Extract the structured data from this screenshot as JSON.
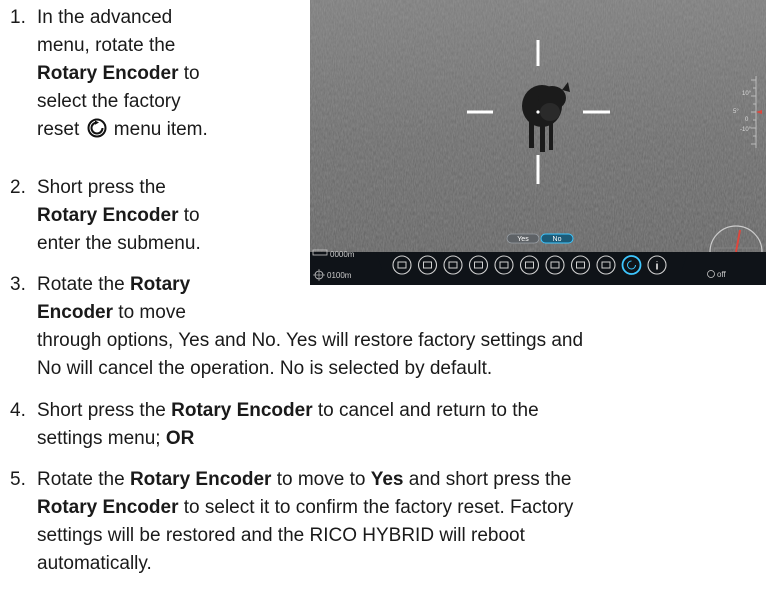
{
  "steps": [
    {
      "number": "1.",
      "lines": [
        [
          "In the advanced"
        ],
        [
          "menu, rotate the"
        ],
        [
          "",
          "Rotary Encoder",
          " to"
        ],
        [
          "select the factory"
        ],
        [
          "reset ",
          "ICON",
          " menu item."
        ]
      ]
    },
    {
      "number": "2.",
      "lines": [
        [
          "Short press the"
        ],
        [
          "",
          "Rotary Encoder",
          " to"
        ],
        [
          "enter the submenu."
        ]
      ]
    },
    {
      "number": "3.",
      "lines": [
        [
          "Rotate the ",
          "Rotary"
        ],
        [
          "",
          "Encoder",
          " to move"
        ],
        [
          "through options, Yes and No. Yes will restore factory settings and"
        ],
        [
          "No will cancel the operation. No is selected by default."
        ]
      ]
    },
    {
      "number": "4.",
      "lines": [
        [
          "Short press the ",
          "Rotary Encoder",
          " to cancel and return to the"
        ],
        [
          "settings menu; ",
          "OR",
          ""
        ]
      ]
    },
    {
      "number": "5.",
      "lines": [
        [
          "Rotate the ",
          "Rotary Encoder",
          " to move to ",
          "Yes",
          " and short press the"
        ],
        [
          "",
          "Rotary Encoder",
          " to select it to confirm the factory reset. Factory"
        ],
        [
          "settings will be restored and the RICO HYBRID will reboot"
        ],
        [
          "automatically."
        ]
      ]
    }
  ],
  "screen": {
    "distance_top": "0000m",
    "distance_bottom": "0100m",
    "dialog_yes": "Yes",
    "dialog_no": "No",
    "power_status": "off",
    "compass_value": "15°",
    "scale_ticks": [
      "10°",
      "5°",
      "0",
      "-10°"
    ],
    "menu_icons": [
      "grid-icon",
      "bluetooth-icon",
      "image-icon",
      "clock-icon",
      "compass-icon",
      "picture-in-picture-icon",
      "snowflake-icon",
      "units-icon",
      "gps-icon",
      "factory-reset-icon",
      "info-icon"
    ],
    "colors": {
      "accent": "#3ec7ff",
      "menu_bar": "#0f1318"
    }
  }
}
